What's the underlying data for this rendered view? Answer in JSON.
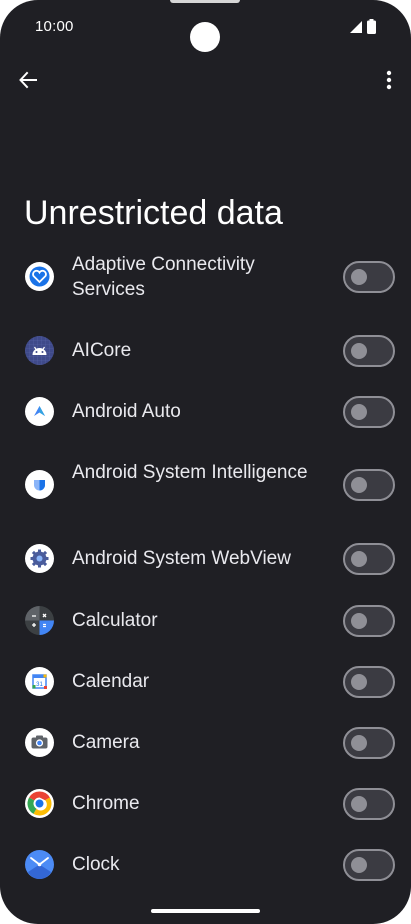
{
  "status_bar": {
    "time": "10:00"
  },
  "header": {
    "title": "Unrestricted data"
  },
  "apps": [
    {
      "label": "Adaptive Connectivity Services",
      "enabled": false,
      "icon": "adaptive-connectivity-icon"
    },
    {
      "label": "AICore",
      "enabled": false,
      "icon": "aicore-icon"
    },
    {
      "label": "Android Auto",
      "enabled": false,
      "icon": "android-auto-icon"
    },
    {
      "label": "Android System Intelligence",
      "enabled": false,
      "icon": "android-system-intelligence-icon"
    },
    {
      "label": "Android System WebView",
      "enabled": false,
      "icon": "webview-icon"
    },
    {
      "label": "Calculator",
      "enabled": false,
      "icon": "calculator-icon"
    },
    {
      "label": "Calendar",
      "enabled": false,
      "icon": "calendar-icon"
    },
    {
      "label": "Camera",
      "enabled": false,
      "icon": "camera-icon"
    },
    {
      "label": "Chrome",
      "enabled": false,
      "icon": "chrome-icon"
    },
    {
      "label": "Clock",
      "enabled": false,
      "icon": "clock-icon"
    }
  ],
  "icons": {
    "back": "arrow-back-icon",
    "more": "more-vert-icon"
  },
  "colors": {
    "background": "#1f1f24",
    "text": "#e9e9ee",
    "toggle_off": "#8f8f96"
  }
}
